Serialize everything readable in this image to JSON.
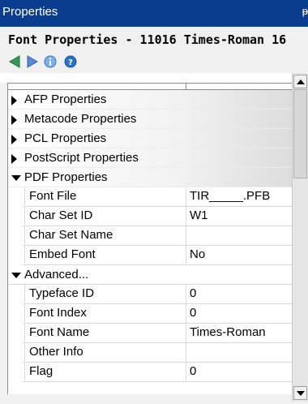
{
  "window": {
    "title": "Properties",
    "pin_glyph": "ᵽ"
  },
  "header": {
    "text": "Font Properties - 11016  Times-Roman 16"
  },
  "toolbar": {
    "icons": [
      "back-arrow-icon",
      "forward-arrow-icon",
      "info-icon",
      "help-icon"
    ],
    "colors": {
      "arrow": "#2f9a52",
      "blue": "#2a73c7"
    }
  },
  "categories": {
    "afp": "AFP Properties",
    "metacode": "Metacode Properties",
    "pcl": "PCL Properties",
    "postscript": "PostScript Properties",
    "pdf": "PDF Properties"
  },
  "pdf_props": [
    {
      "name": "Font File",
      "value": "TIR_____.PFB"
    },
    {
      "name": "Char Set ID",
      "value": "W1"
    },
    {
      "name": "Char Set Name",
      "value": ""
    },
    {
      "name": "Embed Font",
      "value": "No"
    }
  ],
  "advanced": {
    "label": "Advanced...",
    "props": [
      {
        "name": "Typeface ID",
        "value": "0"
      },
      {
        "name": "Font Index",
        "value": "0"
      },
      {
        "name": "Font Name",
        "value": "Times-Roman"
      },
      {
        "name": "Other Info",
        "value": ""
      },
      {
        "name": "Flag",
        "value": "0"
      }
    ]
  }
}
